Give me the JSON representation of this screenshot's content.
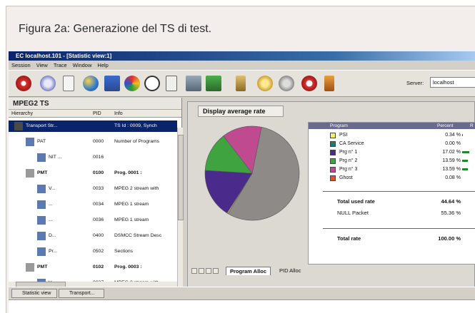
{
  "caption": "Figura 2a: Generazione del TS di test.",
  "window": {
    "title": "EC localhost.101 - [Statistic view:1]",
    "menu": [
      "Session",
      "View",
      "Trace",
      "Window",
      "Help"
    ]
  },
  "toolbar": {
    "server_label": "Server:",
    "server_value": "localhost",
    "icons": [
      "stop-icon",
      "pause-icon",
      "document-icon",
      "globe-icon",
      "chart-icon",
      "palette-icon",
      "stopwatch-icon",
      "folder-icon",
      "image-icon",
      "monitor-icon",
      "info-icon",
      "clock-icon",
      "disk-icon",
      "record-icon",
      "settings-icon"
    ]
  },
  "left": {
    "title": "MPEG2 TS",
    "columns": [
      "Hierarchy",
      "PID",
      "Info"
    ],
    "rows": [
      {
        "name": "Transport Str...",
        "pid": "",
        "info": "TS Id : 0009, Synch",
        "selected": true,
        "indent": 0,
        "bold": false
      },
      {
        "name": "PAT",
        "pid": "0000",
        "info": "Number of Programs",
        "selected": false,
        "indent": 1,
        "bold": false
      },
      {
        "name": "NIT ...",
        "pid": "0016",
        "info": "",
        "selected": false,
        "indent": 2,
        "bold": false
      },
      {
        "name": "PMT",
        "pid": "0100",
        "info": "Prog. 0001 :",
        "selected": false,
        "indent": 1,
        "bold": true
      },
      {
        "name": "V...",
        "pid": "0033",
        "info": "MPEG 2 stream with",
        "selected": false,
        "indent": 2,
        "bold": false
      },
      {
        "name": "...",
        "pid": "0034",
        "info": "MPEG 1 stream",
        "selected": false,
        "indent": 2,
        "bold": false
      },
      {
        "name": "...",
        "pid": "0036",
        "info": "MPEG 1 stream",
        "selected": false,
        "indent": 2,
        "bold": false
      },
      {
        "name": "D...",
        "pid": "0400",
        "info": "DSMCC Stream Desc",
        "selected": false,
        "indent": 2,
        "bold": false
      },
      {
        "name": "Pr...",
        "pid": "0502",
        "info": "Sections",
        "selected": false,
        "indent": 2,
        "bold": false
      },
      {
        "name": "PMT",
        "pid": "0102",
        "info": "Prog. 0003 :",
        "selected": false,
        "indent": 1,
        "bold": true
      },
      {
        "name": "V...",
        "pid": "0037",
        "info": "MPEG 2 stream with",
        "selected": false,
        "indent": 2,
        "bold": false
      }
    ]
  },
  "right": {
    "title": "Display average rate",
    "legend_headers": [
      "Program",
      "Percent",
      "R"
    ],
    "entries": [
      {
        "label": "PSI",
        "percent": "0.34 %",
        "color": "#f0f070"
      },
      {
        "label": "CA Service",
        "percent": "0.00 %",
        "color": "#1f7a6a"
      },
      {
        "label": "Prg n° 1",
        "percent": "17.02 %",
        "color": "#4a2a8a"
      },
      {
        "label": "Prg n° 2",
        "percent": "13.59 %",
        "color": "#3fa33f"
      },
      {
        "label": "Prg n° 3",
        "percent": "13.59 %",
        "color": "#c04a90"
      },
      {
        "label": "Ghost",
        "percent": "0.08 %",
        "color": "#e05030"
      }
    ],
    "totals": [
      {
        "label": "Total used rate",
        "percent": "44.64 %"
      },
      {
        "label": "NULL Packet",
        "percent": "55.36 %"
      },
      {
        "label": "Total rate",
        "percent": "100.00 %"
      }
    ],
    "pie": [
      {
        "value": 55.36,
        "color": "#8e8a88"
      },
      {
        "value": 0.34,
        "color": "#e8e070"
      },
      {
        "value": 17.02,
        "color": "#4a2a8a"
      },
      {
        "value": 13.59,
        "color": "#3fa33f"
      },
      {
        "value": 13.59,
        "color": "#c04a90"
      }
    ],
    "tabs": [
      "Program Alloc",
      "PID Alloc"
    ]
  },
  "taskbar": [
    "Statistic view",
    "Transport..."
  ]
}
